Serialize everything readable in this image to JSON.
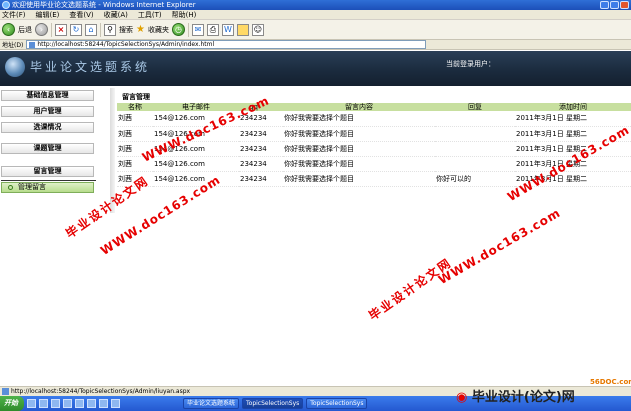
{
  "window": {
    "title": "欢迎使用毕业论文选题系统 - Windows Internet Explorer"
  },
  "menubar": {
    "items": [
      "文件(F)",
      "编辑(E)",
      "查看(V)",
      "收藏(A)",
      "工具(T)",
      "帮助(H)"
    ]
  },
  "toolbar": {
    "back_label": "后退",
    "search_label": "搜索",
    "favorites_label": "收藏夹"
  },
  "address": {
    "label": "地址(D)",
    "url": "http://localhost:58244/TopicSelectionSys/Admin/index.html"
  },
  "header": {
    "site_title": "毕业论文选题系统",
    "login_label": "当前登录用户："
  },
  "sidebar": {
    "items": [
      "基础信息管理",
      "用户管理",
      "选课情况",
      "课题管理",
      "留言管理"
    ],
    "active_item": "管理留言"
  },
  "main": {
    "section_title": "留言管理",
    "columns": [
      "名称",
      "电子邮件",
      "qq",
      "留言内容",
      "回复",
      "添加时间"
    ],
    "rows": [
      {
        "name": "刘茜",
        "email": "154@126.com",
        "qq": "234234",
        "content": "你好我需要选择个题目",
        "reply": "",
        "time": "2011年3月1日 星期二"
      },
      {
        "name": "刘茜",
        "email": "154@126.com",
        "qq": "234234",
        "content": "你好我需要选择个题目",
        "reply": "",
        "time": "2011年3月1日 星期二"
      },
      {
        "name": "刘茜",
        "email": "154@126.com",
        "qq": "234234",
        "content": "你好我需要选择个题目",
        "reply": "",
        "time": "2011年3月1日 星期二"
      },
      {
        "name": "刘茜",
        "email": "154@126.com",
        "qq": "234234",
        "content": "你好我需要选择个题目",
        "reply": "",
        "time": "2011年3月1日 星期二"
      },
      {
        "name": "刘茜",
        "email": "154@126.com",
        "qq": "234234",
        "content": "你好我需要选择个题目",
        "reply": "你好可以的",
        "time": "2011年3月1日 星期二"
      }
    ]
  },
  "watermarks": {
    "cn": "毕业设计论文网",
    "url": "WWW.doc163.com",
    "corner_text": "毕业设计(论文)网",
    "corner_site": "56DOC.com"
  },
  "statusbar": {
    "url": "http://localhost:58244/TopicSelectionSys/Admin/liuyan.aspx"
  },
  "taskbar": {
    "start_label": "开始",
    "items": [
      "毕业论文选题系统",
      "TopicSelectionSys",
      "TopicSelectionSys"
    ]
  },
  "colors": {
    "header_bg": "#1b2b3e",
    "table_header_bg": "#c7df9f",
    "watermark_red": "#e60000",
    "taskbar_blue": "#2458d0"
  }
}
